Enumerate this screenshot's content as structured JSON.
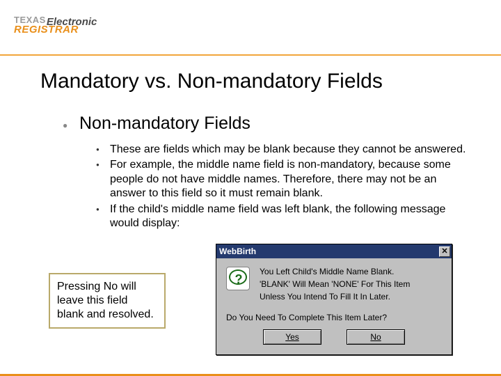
{
  "logo": {
    "line1a": "TEXAS",
    "line1b": "Electronic",
    "line2": "REGISTRAR"
  },
  "title": "Mandatory vs. Non-mandatory Fields",
  "section": {
    "heading": "Non-mandatory Fields",
    "bullets": [
      "These are fields which may be blank because they cannot be answered.",
      "For example, the middle name field is non-mandatory, because some people do not have middle names.  Therefore, there may not be an answer to this field so it must remain blank.",
      "If the child's middle name field was left blank, the following message would display:"
    ]
  },
  "callout": "Pressing No will leave this field blank and resolved.",
  "dialog": {
    "title": "WebBirth",
    "close_glyph": "✕",
    "message": {
      "line1": "You Left Child's Middle Name Blank.",
      "line2": "'BLANK' Will Mean 'NONE' For This Item",
      "line3": "Unless You Intend To Fill It In Later."
    },
    "prompt": "Do You Need To Complete This Item Later?",
    "buttons": {
      "yes": "Yes",
      "no": "No"
    }
  }
}
